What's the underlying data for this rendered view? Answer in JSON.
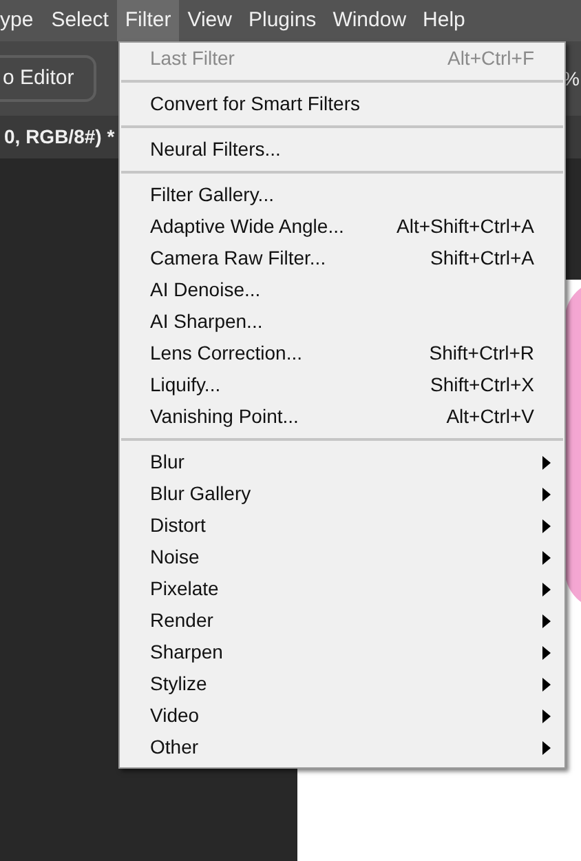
{
  "menubar": [
    {
      "label": "ype",
      "selected": false
    },
    {
      "label": "Select",
      "selected": false
    },
    {
      "label": "Filter",
      "selected": true
    },
    {
      "label": "View",
      "selected": false
    },
    {
      "label": "Plugins",
      "selected": false
    },
    {
      "label": "Window",
      "selected": false
    },
    {
      "label": "Help",
      "selected": false
    }
  ],
  "options_bar": {
    "button": "o Editor",
    "zoom_text": "%"
  },
  "document_tab": {
    "title": "0, RGB/8#) *"
  },
  "menu": {
    "items": [
      {
        "kind": "command",
        "label": "Last Filter",
        "shortcut": "Alt+Ctrl+F",
        "disabled": true
      },
      {
        "kind": "separator"
      },
      {
        "kind": "command",
        "label": "Convert for Smart Filters",
        "disabled": false
      },
      {
        "kind": "separator"
      },
      {
        "kind": "command",
        "label": "Neural Filters...",
        "disabled": false
      },
      {
        "kind": "separator"
      },
      {
        "kind": "command",
        "label": "Filter Gallery...",
        "disabled": false
      },
      {
        "kind": "command",
        "label": "Adaptive Wide Angle...",
        "shortcut": "Alt+Shift+Ctrl+A",
        "disabled": false
      },
      {
        "kind": "command",
        "label": "Camera Raw Filter...",
        "shortcut": "Shift+Ctrl+A",
        "disabled": false
      },
      {
        "kind": "command",
        "label": "AI Denoise...",
        "disabled": false
      },
      {
        "kind": "command",
        "label": "AI Sharpen...",
        "disabled": false
      },
      {
        "kind": "command",
        "label": "Lens Correction...",
        "shortcut": "Shift+Ctrl+R",
        "disabled": false
      },
      {
        "kind": "command",
        "label": "Liquify...",
        "shortcut": "Shift+Ctrl+X",
        "disabled": false
      },
      {
        "kind": "command",
        "label": "Vanishing Point...",
        "shortcut": "Alt+Ctrl+V",
        "disabled": false
      },
      {
        "kind": "separator"
      },
      {
        "kind": "submenu",
        "label": "Blur",
        "disabled": false
      },
      {
        "kind": "submenu",
        "label": "Blur Gallery",
        "disabled": false
      },
      {
        "kind": "submenu",
        "label": "Distort",
        "disabled": false
      },
      {
        "kind": "submenu",
        "label": "Noise",
        "disabled": false
      },
      {
        "kind": "submenu",
        "label": "Pixelate",
        "disabled": false
      },
      {
        "kind": "submenu",
        "label": "Render",
        "disabled": false
      },
      {
        "kind": "submenu",
        "label": "Sharpen",
        "disabled": false
      },
      {
        "kind": "submenu",
        "label": "Stylize",
        "disabled": false
      },
      {
        "kind": "submenu",
        "label": "Video",
        "disabled": false
      },
      {
        "kind": "submenu",
        "label": "Other",
        "disabled": false
      }
    ]
  }
}
